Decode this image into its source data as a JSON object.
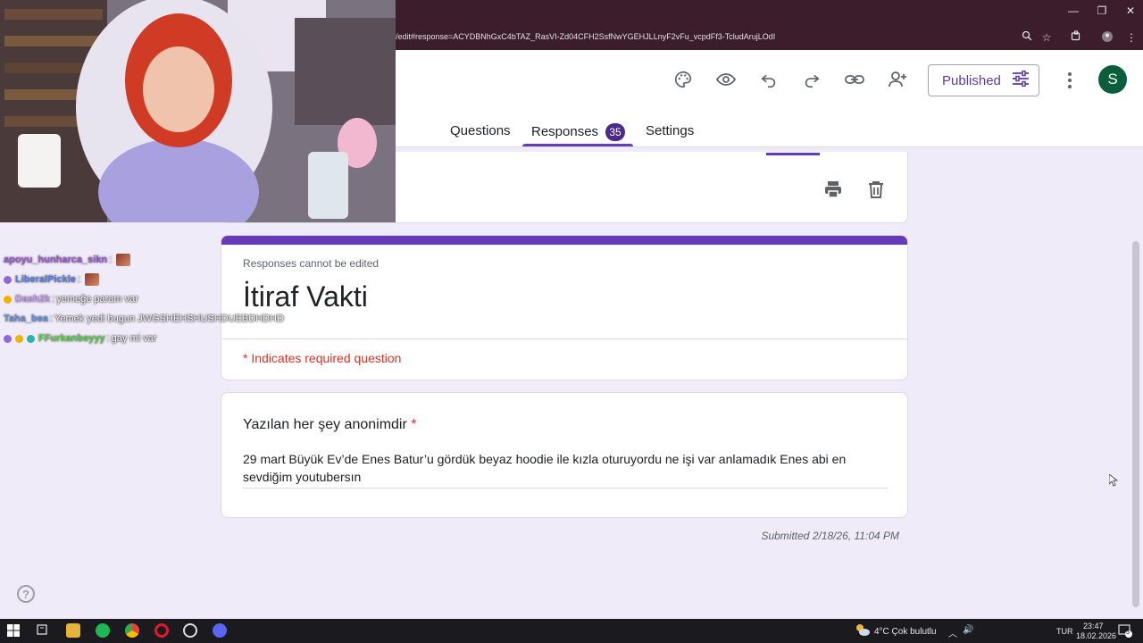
{
  "browser": {
    "url": "/edit#response=ACYDBNhGxC4bTAZ_RasVI-Zd04CFH2SsfNwYGEHJLLnyF2vFu_vcpdFf3-TcludArujLOdI",
    "minimize": "—",
    "restore": "❐",
    "close": "✕"
  },
  "header": {
    "published_label": "Published",
    "avatar_letter": "S",
    "tabs": [
      {
        "label": "Questions"
      },
      {
        "label": "Responses",
        "count": "35"
      },
      {
        "label": "Settings"
      }
    ]
  },
  "form": {
    "note": "Responses cannot be edited",
    "title": "İtiraf Vakti",
    "required_note": "* Indicates required question",
    "question": {
      "title": "Yazılan her şey anonimdir",
      "required_mark": "*",
      "answer": "29 mart Büyük Ev’de Enes Batur’u gördük beyaz hoodie ile kızla oturuyordu ne işi var anlamadık Enes abi en sevdiğim youtubersın"
    },
    "submitted": "Submitted 2/18/26, 11:04 PM"
  },
  "help_label": "?",
  "chat": [
    {
      "user": "apoyu_hunharca_sikn",
      "sep": ":",
      "msg": "",
      "color": "#9b59d0",
      "emote": true
    },
    {
      "user": "LiberalPickle",
      "sep": ":",
      "msg": "",
      "color": "#5b7ee5",
      "emote": true
    },
    {
      "user": "Dash2k",
      "sep": ":",
      "msg": "yemeğe param var",
      "color": "#c49bf0",
      "emote": false
    },
    {
      "user": "Taha_bea",
      "sep": ":",
      "msg": "Yemek yedi bugun JWGSHEHSHUSHDUEBDHDHD",
      "color": "#6a8fd8",
      "emote": false
    },
    {
      "user": "FFurkanbeyyy",
      "sep": ":",
      "msg": "gay mi var",
      "color": "#5ccf4a",
      "emote": false
    }
  ],
  "taskbar": {
    "weather": "4°C  Çok bulutlu",
    "lang": "TUR",
    "time": "23:47",
    "date": "18.02.2026",
    "notif_count": "5"
  },
  "colors": {
    "accent": "#673ab7",
    "required": "#d93025",
    "background": "#f0ebf8"
  }
}
